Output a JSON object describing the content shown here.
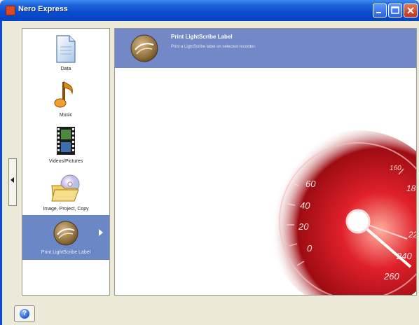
{
  "window": {
    "title": "Nero Express"
  },
  "sidebar": {
    "items": [
      {
        "label": "Data",
        "icon": "document-icon"
      },
      {
        "label": "Music",
        "icon": "music-note-icon"
      },
      {
        "label": "Videos/Pictures",
        "icon": "film-strip-icon"
      },
      {
        "label": "Image, Project, Copy",
        "icon": "folder-disc-icon"
      },
      {
        "label": "Print LightScribe Label",
        "icon": "lightscribe-disc-icon",
        "selected": true
      }
    ]
  },
  "main": {
    "task": {
      "title": "Print LightScribe Label",
      "description": "Print a LightScribe label on selected recorder."
    },
    "speedometer_labels": [
      "60",
      "40",
      "20",
      "0",
      "160",
      "18",
      "22",
      "240",
      "260"
    ]
  },
  "colors": {
    "title_bar": "#0a4ccf",
    "selection": "#7388c7",
    "speedometer": "#c8141a"
  }
}
